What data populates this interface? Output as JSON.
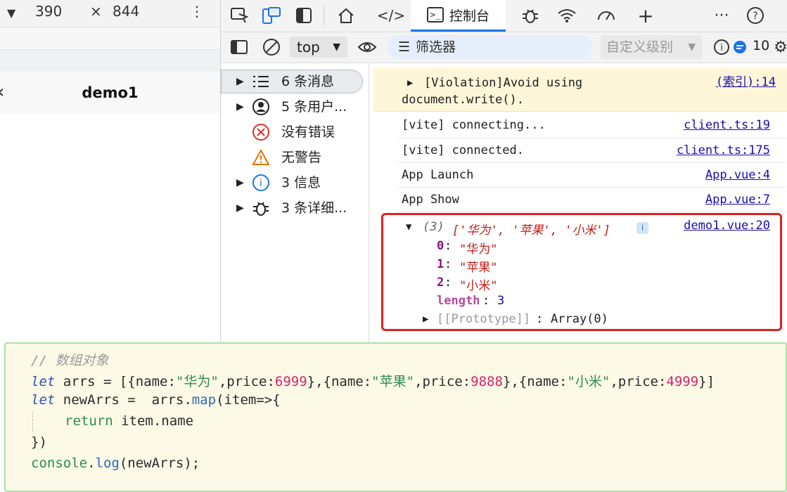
{
  "device": {
    "width": "390",
    "times": "×",
    "height": "844",
    "more": "⋮"
  },
  "app": {
    "title": "demo1",
    "back": "‹"
  },
  "devtools": {
    "tabs": {
      "console_label": "控制台"
    },
    "toolbar": {
      "context": "top",
      "filter_placeholder": "筛选器",
      "levels": "自定义级别",
      "issue_count": "10"
    },
    "sidebar": [
      {
        "label": "6 条消息",
        "icon": "list-icon",
        "expandable": true
      },
      {
        "label": "5 条用户...",
        "icon": "user-icon",
        "expandable": true
      },
      {
        "label": "没有错误",
        "icon": "error-icon",
        "expandable": false
      },
      {
        "label": "无警告",
        "icon": "warning-icon",
        "expandable": false
      },
      {
        "label": "3 信息",
        "icon": "info-icon",
        "expandable": true
      },
      {
        "label": "3 条详细...",
        "icon": "bug-icon",
        "expandable": true
      }
    ],
    "console": {
      "violation_line1": "[Violation]Avoid using",
      "violation_line2": "document.write().",
      "violation_src": "(索引):14",
      "rows": [
        {
          "text": "[vite] connecting...",
          "src": "client.ts:19"
        },
        {
          "text": "[vite] connected.",
          "src": "client.ts:175"
        },
        {
          "text": "App Launch",
          "src": "App.vue:4"
        },
        {
          "text": "App Show",
          "src": "App.vue:7"
        }
      ],
      "array": {
        "summary_count": "(3)",
        "summary_items": "['华为', '苹果', '小米']",
        "src": "demo1.vue:20",
        "entries": [
          {
            "key": "0",
            "value": "\"华为\""
          },
          {
            "key": "1",
            "value": "\"苹果\""
          },
          {
            "key": "2",
            "value": "\"小米\""
          }
        ],
        "length_key": "length",
        "length_value": "3",
        "prototype_key": "[[Prototype]]",
        "prototype_value": "Array(0)"
      }
    }
  },
  "code": {
    "comment": "// 数组对象",
    "line2_let": "let",
    "line2_var": " arrs = [{name:",
    "s1": "\"华为\"",
    "p1": ",price:",
    "n1": "6999",
    "m1": "},{name:",
    "s2": "\"苹果\"",
    "p2": ",price:",
    "n2": "9888",
    "m2": "},{name:",
    "s3": "\"小米\"",
    "p3": ",price:",
    "n3": "4999",
    "e3": "}]",
    "line3_let": "let",
    "line3_a": " newArrs =  arrs.",
    "line3_map": "map",
    "line3_b": "(item=>{",
    "line4_ret": "return",
    "line4_b": " item.name",
    "line5": "})",
    "line6_obj": "console",
    "line6_dot": ".",
    "line6_fn": "log",
    "line6_args": "(newArrs);"
  }
}
